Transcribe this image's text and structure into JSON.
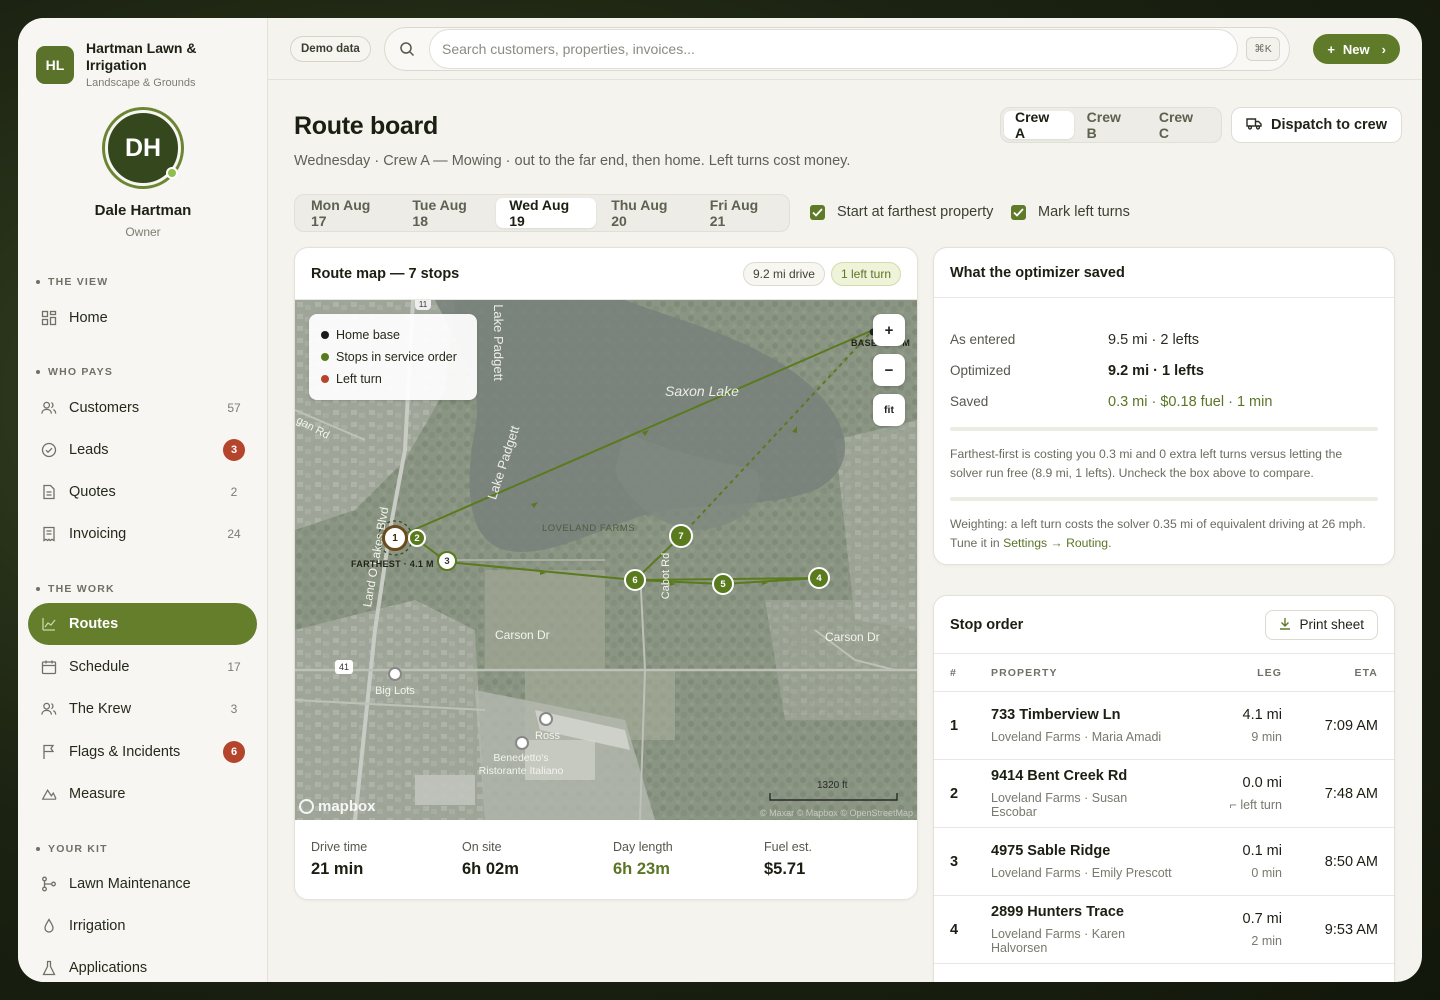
{
  "brand": {
    "logo": "HL",
    "name": "Hartman Lawn & Irrigation",
    "sub": "Landscape & Grounds"
  },
  "profile": {
    "initials": "DH",
    "name": "Dale Hartman",
    "role": "Owner"
  },
  "nav": {
    "sections": [
      {
        "label": "THE VIEW"
      },
      {
        "label": "WHO PAYS"
      },
      {
        "label": "THE WORK"
      },
      {
        "label": "YOUR KIT"
      }
    ],
    "items": [
      {
        "label": "Home",
        "icon": "grid-icon"
      },
      {
        "label": "Customers",
        "count": "57",
        "icon": "users-icon"
      },
      {
        "label": "Leads",
        "badge": "3",
        "icon": "check-circle-icon"
      },
      {
        "label": "Quotes",
        "count": "2",
        "icon": "document-icon"
      },
      {
        "label": "Invoicing",
        "count": "24",
        "icon": "receipt-icon"
      },
      {
        "label": "Routes",
        "icon": "route-icon",
        "active": true
      },
      {
        "label": "Schedule",
        "count": "17",
        "icon": "calendar-icon"
      },
      {
        "label": "The Krew",
        "count": "3",
        "icon": "users-icon"
      },
      {
        "label": "Flags & Incidents",
        "badge": "6",
        "icon": "flag-icon"
      },
      {
        "label": "Measure",
        "icon": "measure-icon"
      },
      {
        "label": "Lawn Maintenance",
        "icon": "branch-icon"
      },
      {
        "label": "Irrigation",
        "icon": "droplet-icon"
      },
      {
        "label": "Applications",
        "icon": "flask-icon"
      }
    ]
  },
  "topbar": {
    "demo": "Demo data",
    "search_placeholder": "Search customers, properties, invoices...",
    "kbd": "⌘K",
    "new_label": "New"
  },
  "page": {
    "title": "Route board",
    "subtitle": "Wednesday · Crew A — Mowing · out to the far end, then home. Left turns cost money.",
    "crews": [
      "Crew A",
      "Crew B",
      "Crew C"
    ],
    "dispatch_label": "Dispatch to crew",
    "days": [
      "Mon Aug 17",
      "Tue Aug 18",
      "Wed Aug 19",
      "Thu Aug 20",
      "Fri Aug 21"
    ],
    "check_farthest": "Start at farthest property",
    "check_left": "Mark left turns"
  },
  "map_card": {
    "title": "Route map — 7 stops",
    "drive_chip": "9.2 mi drive",
    "left_chip": "1 left turn",
    "legend": [
      "Home base",
      "Stops in service order",
      "Left turn"
    ],
    "controls": {
      "zoom_in": "+",
      "zoom_out": "−",
      "fit": "fit"
    },
    "labels": {
      "saxon": "Saxon Lake",
      "padgett1": "Lake Padgett",
      "padgett2": "Lake Padgett",
      "loveland": "LOVELAND FARMS",
      "carson1": "Carson Dr",
      "carson2": "Carson Dr",
      "landolakes": "Land O Lakes Blvd",
      "cabot": "Cabot Rd",
      "bigLots": "Big Lots",
      "ross": "Ross",
      "benedettos": "Benedetto's Ristorante Italiano",
      "logan": "gan Rd",
      "base": "BASE · 1.1 M",
      "farthest": "FARTHEST · 4.1 M",
      "route41": "41",
      "route11": "11",
      "scale": "1320 ft",
      "mapbox": "mapbox",
      "attrib": "© Maxar © Mapbox © OpenStreetMap"
    },
    "stop_numbers": [
      "1",
      "2",
      "3",
      "4",
      "5",
      "6",
      "7"
    ],
    "stats": [
      {
        "label": "Drive time",
        "value": "21 min"
      },
      {
        "label": "On site",
        "value": "6h 02m"
      },
      {
        "label": "Day length",
        "value": "6h 23m",
        "accent": true
      },
      {
        "label": "Fuel est.",
        "value": "$5.71"
      }
    ]
  },
  "saved_card": {
    "title": "What the optimizer saved",
    "rows": [
      {
        "key": "As entered",
        "value": "9.5 mi · 2 lefts"
      },
      {
        "key": "Optimized",
        "value": "9.2 mi · 1 lefts"
      },
      {
        "key": "Saved",
        "value": "0.3 mi · $0.18 fuel · 1 min"
      }
    ],
    "note1": "Farthest-first is costing you 0.3 mi and 0 extra left turns versus letting the solver run free (8.9 mi, 1 lefts). Uncheck the box above to compare.",
    "note2_prefix": "Weighting: a left turn costs the solver 0.35 mi of equivalent driving at 26 mph. Tune it in ",
    "note2_link": "Settings → Routing",
    "note2_suffix": "."
  },
  "stop_card": {
    "title": "Stop order",
    "print_label": "Print sheet",
    "headers": {
      "num": "#",
      "property": "PROPERTY",
      "leg": "LEG",
      "eta": "ETA"
    },
    "rows": [
      {
        "num": "1",
        "name": "733 Timberview Ln",
        "sub": "Loveland Farms · Maria Amadi",
        "leg": "4.1 mi",
        "leg_sub": "9 min",
        "eta": "7:09 AM"
      },
      {
        "num": "2",
        "name": "9414 Bent Creek Rd",
        "sub": "Loveland Farms · Susan Escobar",
        "leg": "0.0 mi",
        "leg_sub": "left turn",
        "eta": "7:48 AM"
      },
      {
        "num": "3",
        "name": "4975 Sable Ridge",
        "sub": "Loveland Farms · Emily Prescott",
        "leg": "0.1 mi",
        "leg_sub": "0 min",
        "eta": "8:50 AM"
      },
      {
        "num": "4",
        "name": "2899 Hunters Trace",
        "sub": "Loveland Farms · Karen Halvorsen",
        "leg": "0.7 mi",
        "leg_sub": "2 min",
        "eta": "9:53 AM"
      }
    ]
  },
  "colors": {
    "accent": "#5f7a28",
    "badge": "#b5442d",
    "route": "#5a7a1e"
  }
}
